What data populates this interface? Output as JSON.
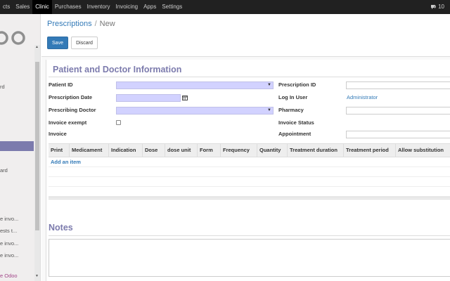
{
  "topbar": {
    "menu": [
      "cts",
      "Sales",
      "Clinic",
      "Purchases",
      "Inventory",
      "Invoicing",
      "Apps",
      "Settings"
    ],
    "active": "Clinic",
    "chat_count": "10"
  },
  "sidebar": {
    "items": [
      "rd",
      "ard",
      "e invo...",
      "ests t...",
      "e invo...",
      "e invo..."
    ],
    "powered": "e Odoo"
  },
  "breadcrumb": {
    "parent": "Prescriptions",
    "separator": "/",
    "current": "New"
  },
  "buttons": {
    "save": "Save",
    "discard": "Discard"
  },
  "section_title": "Patient and Doctor Information",
  "left_labels": {
    "patient_id": "Patient ID",
    "prescription_date": "Prescription Date",
    "prescribing_doctor": "Prescribing Doctor",
    "invoice_exempt": "Invoice exempt",
    "invoice": "Invoice"
  },
  "right_labels": {
    "prescription_id": "Prescription ID",
    "log_in_user": "Log In User",
    "pharmacy": "Pharmacy",
    "invoice_status": "Invoice Status",
    "appointment": "Appointment"
  },
  "values": {
    "log_in_user": "Administrator"
  },
  "table": {
    "columns": [
      "Print",
      "Medicament",
      "Indication",
      "Dose",
      "dose unit",
      "Form",
      "Frequency",
      "Quantity",
      "Treatment duration",
      "Treatment period",
      "Allow substitution"
    ],
    "add_item": "Add an item"
  },
  "notes_title": "Notes",
  "colors": {
    "accent": "#7c7bad",
    "primary": "#337ab7",
    "required": "#d2d2ff",
    "navbar": "#212121"
  }
}
